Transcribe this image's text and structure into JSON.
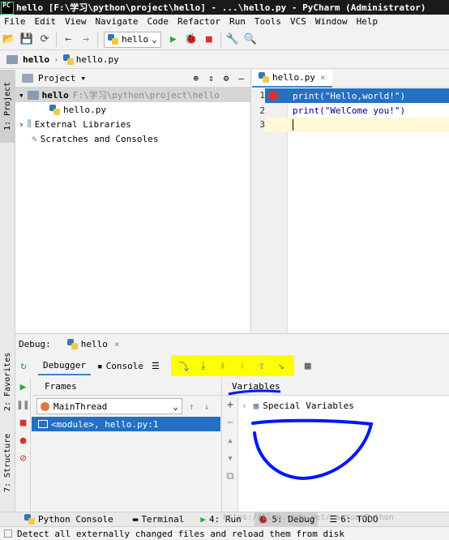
{
  "window": {
    "title": "hello [F:\\学习\\python\\project\\hello] - ...\\hello.py - PyCharm (Administrator)"
  },
  "menu": [
    "File",
    "Edit",
    "View",
    "Navigate",
    "Code",
    "Refactor",
    "Run",
    "Tools",
    "VCS",
    "Window",
    "Help"
  ],
  "toolbar": {
    "run_config": "hello"
  },
  "breadcrumb": {
    "project": "hello",
    "file": "hello.py"
  },
  "sidebar_tabs": {
    "project": "1: Project",
    "favorites": "2: Favorites",
    "structure": "7: Structure"
  },
  "project_panel": {
    "title": "Project",
    "root": "hello",
    "root_path": "F:\\学习\\python\\project\\hello",
    "file": "hello.py",
    "external_libraries": "External Libraries",
    "scratches": "Scratches and Consoles"
  },
  "editor": {
    "tab": "hello.py",
    "lines": [
      {
        "num": "1",
        "code": "print(\"Hello,world!\")"
      },
      {
        "num": "2",
        "code": "print(\"WelCome you!\")"
      },
      {
        "num": "3",
        "code": ""
      }
    ]
  },
  "debug": {
    "label": "Debug:",
    "config": "hello",
    "tab_debugger": "Debugger",
    "tab_console": "Console",
    "frames_label": "Frames",
    "variables_label": "Variables",
    "thread": "MainThread",
    "frame": "<module>, hello.py:1",
    "special_variables": "Special Variables"
  },
  "bottom_tabs": {
    "python_console": "Python Console",
    "terminal": "Terminal",
    "run": "4: Run",
    "debug": "5: Debug",
    "todo": "6: TODO"
  },
  "status": {
    "message": "Detect all externally changed files and reload them from disk",
    "watermark": "https://blog.csdn.net/LaoYuanPython"
  },
  "colors": {
    "highlight": "#ffff00",
    "annotation": "#0016ff",
    "selection": "#2470c4",
    "caret_line": "#fff8d6"
  }
}
